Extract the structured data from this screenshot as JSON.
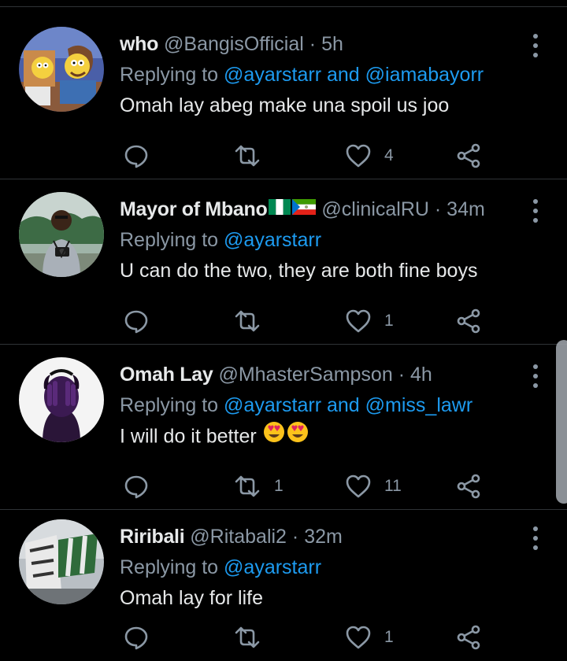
{
  "tweets": [
    {
      "name": "who",
      "handle": "@BangisOfficial",
      "time": "5h",
      "replying_prefix": "Replying to",
      "mentions": [
        "@ayarstarr",
        "@iamabayorr"
      ],
      "joiner": "and",
      "text": "Omah lay abeg make una spoil us joo",
      "emoji": "",
      "reply_count": "",
      "retweet_count": "",
      "like_count": "4",
      "avatar": "simpsons-cartoon-avatar"
    },
    {
      "name": "Mayor of Mbano",
      "flags": [
        "nigeria-flag-icon",
        "equatorial-guinea-flag-icon"
      ],
      "handle": "@clinicalRU",
      "time": "34m",
      "replying_prefix": "Replying to",
      "mentions": [
        "@ayarstarr"
      ],
      "joiner": "",
      "text": "U can do the two, they are both fine boys",
      "emoji": "",
      "reply_count": "",
      "retweet_count": "",
      "like_count": "1",
      "avatar": "man-with-camera-avatar"
    },
    {
      "name": "Omah Lay",
      "handle": "@MhasterSampson",
      "time": "4h",
      "replying_prefix": "Replying to",
      "mentions": [
        "@ayarstarr",
        "@miss_lawr"
      ],
      "joiner": "and",
      "text": "I will do it better",
      "emoji": "😍😍",
      "reply_count": "",
      "retweet_count": "1",
      "like_count": "11",
      "avatar": "purple-hands-face-avatar"
    },
    {
      "name": "Riribali",
      "handle": "@Ritabali2",
      "time": "32m",
      "replying_prefix": "Replying to",
      "mentions": [
        "@ayarstarr"
      ],
      "joiner": "",
      "text": "Omah lay for life",
      "emoji": "",
      "reply_count": "",
      "retweet_count": "",
      "like_count": "1",
      "avatar": "endsars-protest-sign-avatar"
    }
  ],
  "separator": "·",
  "colors": {
    "background": "#000000",
    "primary_text": "#e7e9ea",
    "secondary_text": "#8b98a5",
    "accent": "#1d9bf0",
    "divider": "#2f3336"
  }
}
